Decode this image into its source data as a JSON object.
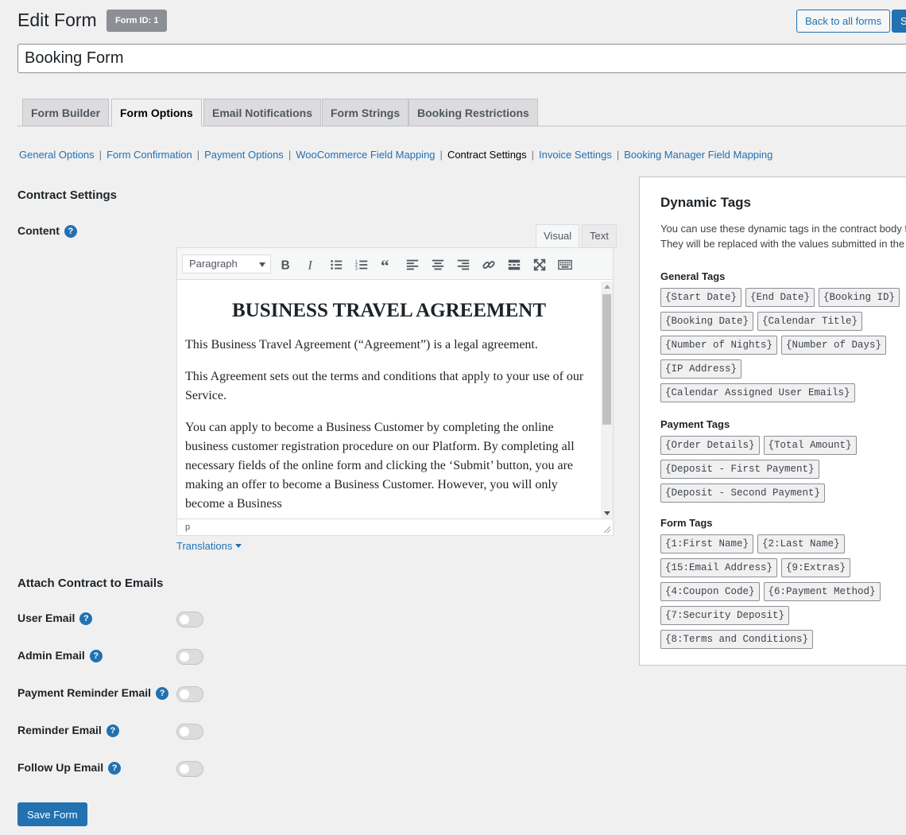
{
  "header": {
    "title": "Edit Form",
    "form_id_badge": "Form ID: 1",
    "back_button": "Back to all forms",
    "save_button_partial": "S",
    "form_title_value": "Booking Form"
  },
  "tabs": [
    {
      "label": "Form Builder",
      "active": false
    },
    {
      "label": "Form Options",
      "active": true
    },
    {
      "label": "Email Notifications",
      "active": false
    },
    {
      "label": "Form Strings",
      "active": false
    },
    {
      "label": "Booking Restrictions",
      "active": false
    }
  ],
  "subnav": [
    {
      "label": "General Options",
      "current": false
    },
    {
      "label": "Form Confirmation",
      "current": false
    },
    {
      "label": "Payment Options",
      "current": false
    },
    {
      "label": "WooCommerce Field Mapping",
      "current": false
    },
    {
      "label": "Contract Settings",
      "current": true
    },
    {
      "label": "Invoice Settings",
      "current": false
    },
    {
      "label": "Booking Manager Field Mapping",
      "current": false
    }
  ],
  "contract": {
    "section_title": "Contract Settings",
    "content_label": "Content",
    "help_glyph": "?",
    "editor_tabs": {
      "visual": "Visual",
      "text": "Text"
    },
    "format_select": "Paragraph",
    "toolbar_icons": [
      "bold-icon",
      "italic-icon",
      "bullet-list-icon",
      "numbered-list-icon",
      "blockquote-icon",
      "align-left-icon",
      "align-center-icon",
      "align-right-icon",
      "link-icon",
      "read-more-icon",
      "fullscreen-icon",
      "toolbar-toggle-icon"
    ],
    "heading": "BUSINESS TRAVEL AGREEMENT",
    "paragraphs": [
      "This Business Travel Agreement (“Agreement”) is a legal agreement.",
      "This Agreement sets out the terms and conditions that apply to your use of our Service.",
      "You can apply to become a Business Customer by completing the online business customer registration procedure on our Platform. By completing all necessary fields of the online form and clicking the ‘Submit’ button, you are making an offer to become a Business Customer. However, you will only become a Business"
    ],
    "status_path": "p",
    "translations_link": "Translations"
  },
  "attach": {
    "section_title": "Attach Contract to Emails",
    "rows": [
      {
        "label": "User Email",
        "enabled": false
      },
      {
        "label": "Admin Email",
        "enabled": false
      },
      {
        "label": "Payment Reminder Email",
        "enabled": false
      },
      {
        "label": "Reminder Email",
        "enabled": false
      },
      {
        "label": "Follow Up Email",
        "enabled": false
      }
    ]
  },
  "save_form_button": "Save Form",
  "dynamic_tags": {
    "title": "Dynamic Tags",
    "description_line1": "You can use these dynamic tags in the contract body f",
    "description_line2": "They will be replaced with the values submitted in the",
    "groups": [
      {
        "title": "General Tags",
        "tags": [
          "{Start Date}",
          "{End Date}",
          "{Booking ID}",
          "{Booking Date}",
          "{Calendar Title}",
          "{Number of Nights}",
          "{Number of Days}",
          "{IP Address}",
          "{Calendar Assigned User Emails}"
        ]
      },
      {
        "title": "Payment Tags",
        "tags": [
          "{Order Details}",
          "{Total Amount}",
          "{Deposit - First Payment}",
          "{Deposit - Second Payment}"
        ]
      },
      {
        "title": "Form Tags",
        "tags": [
          "{1:First Name}",
          "{2:Last Name}",
          "{15:Email Address}",
          "{9:Extras}",
          "{4:Coupon Code}",
          "{6:Payment Method}",
          "{7:Security Deposit}",
          "{8:Terms and Conditions}"
        ]
      }
    ]
  },
  "colors": {
    "accent": "#2271b1",
    "background": "#f0f0f1",
    "badge": "#8c8f94"
  }
}
